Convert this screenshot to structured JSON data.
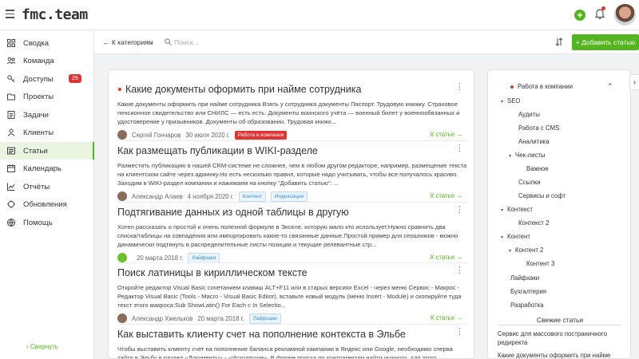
{
  "brand": {
    "logo_text": "fmc.team",
    "accent": "#55b520",
    "danger": "#e03434"
  },
  "sidebar": {
    "items": [
      {
        "label": "Сводка",
        "icon": "grid-icon"
      },
      {
        "label": "Команда",
        "icon": "team-icon"
      },
      {
        "label": "Доступы",
        "icon": "key-icon",
        "badge": "29"
      },
      {
        "label": "Проекты",
        "icon": "folder-icon"
      },
      {
        "label": "Задачи",
        "icon": "tasks-icon"
      },
      {
        "label": "Клиенты",
        "icon": "clients-icon"
      },
      {
        "label": "Статьи",
        "icon": "articles-icon",
        "active": true
      },
      {
        "label": "Календарь",
        "icon": "calendar-icon"
      },
      {
        "label": "Отчёты",
        "icon": "chart-icon"
      },
      {
        "label": "Обновления",
        "icon": "updates-icon"
      },
      {
        "label": "Помощь",
        "icon": "help-icon"
      }
    ],
    "collapse_label": "‹ Свернуть"
  },
  "toolbar": {
    "back_label": "← К категориям",
    "search_placeholder": "Поиск...",
    "add_label": "Добавить статью"
  },
  "articles": [
    {
      "title": "Какие документы оформить при найме сотрудника",
      "body": "Какие документы оформить при найме сотрудника Взять у сотрудника документы Паспорт. Трудовую книжку. Страховое пенсионное свидетельство или СНИЛС — есть есть. Документы воинского учёта — военный билет у военнообязанных и удостоверение у призывников. Документы об образовании. Трудовая книжк...",
      "author": "Сергей Гончаров",
      "date": "30 июля 2020 г.",
      "tag": "Работа в компании",
      "go": "К статье →"
    },
    {
      "title": "Как размещать публикации в WIKI-разделе",
      "body": "Разместить публикацию в нашей CRM-системе не сложнее, чем в любом другом редакторе, например, размещение текста на клиентском сайте через админку.Но есть несколько правил, которые надо учитывать, чтобы все получалось красиво. Заходим в WIKI-раздел компании и нажимаем на кнопку \"Добавить статью\": ...",
      "author": "Александр Алаев",
      "date": "4 ноября 2020 г.",
      "tags": [
        "Контент",
        "Индексация"
      ],
      "go": "К статье →"
    },
    {
      "title": "Подтягивание данных из одной таблицы в другую",
      "body": "Хотел рассказать о простой и очень полезной формуле в Экселе, которую мало кто использует.Нужно сравнить два списка/таблицы на совпадения или импортировать какие-то связанные данные.Простой пример для сеошников - можно динамически подтянуть в распределительные листы позиции и текущие релевантные стр...",
      "author": "",
      "date": "20 марта 2018 г.",
      "tag": "Лайфхаки",
      "go": "К статье →"
    },
    {
      "title": "Поиск латиницы в кириллическом тексте",
      "body": "Откройте редактор Visual Basic сочетанием клавиш ALT+F11 или в старых версиях Excel - через меню Сервис - Макрос - Редактор Visual Basic (Tools - Macro - Visual Basic Editor), вставьте новый модуль (меню Insert - Module) и скопируйте туда текст этого макроса:Sub ShowLatin() For Each c In Selectio...",
      "author": "Александр Хмельков",
      "date": "20 марта 2018 г.",
      "tag": "Лайфхаки",
      "go": "К статье →"
    },
    {
      "title": "Как выставить клиенту счет на пополнение контекста в Эльбе",
      "body": "Чтобы выставить клиенту счет на пополнение баланса рекламной кампании в Яндекс или Google, необходимо сперва зайти в Эльбу в раздел «Документы» - «Исходящие». В форме поиска по контрагентам найти нужного, для этого"
    }
  ],
  "categories": {
    "current": "Работа в компании",
    "tree": [
      {
        "label": "SEO",
        "caret": "▾"
      },
      {
        "label": "Аудиты"
      },
      {
        "label": "Работа с CMS"
      },
      {
        "label": "Аналитика"
      },
      {
        "label": "Чек-листы",
        "caret": "▾"
      },
      {
        "label": "Важное"
      },
      {
        "label": "Ссылки"
      },
      {
        "label": "Сервисы и софт"
      },
      {
        "label": "Контекст",
        "caret": "▾"
      },
      {
        "label": "Контекст 2"
      },
      {
        "label": "Контент",
        "caret": "▾"
      },
      {
        "label": "Контент 2",
        "caret": "▾"
      },
      {
        "label": "Контент 3"
      },
      {
        "label": "Лайфхаки"
      },
      {
        "label": "Бухгалтерия"
      },
      {
        "label": "Разработка"
      }
    ]
  },
  "fresh": {
    "title": "Свежие статьи",
    "items": [
      "Сервис для массового постраничного редиректа",
      "Какие документы оформить при найме"
    ]
  }
}
